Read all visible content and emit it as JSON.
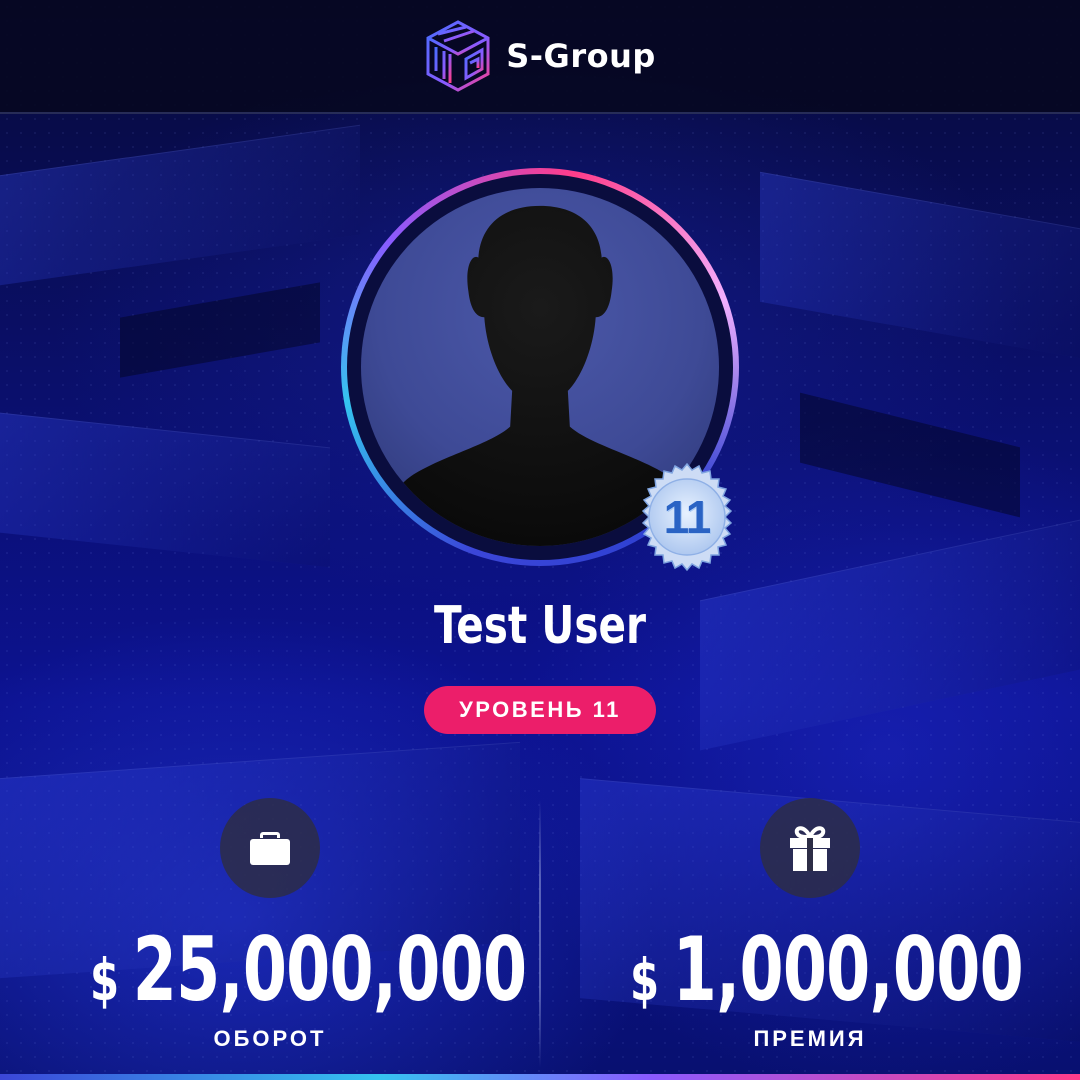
{
  "brand": {
    "name": "S-Group",
    "logo_icon": "cube-logo-icon"
  },
  "profile": {
    "name": "Test User",
    "level_number": "11",
    "level_label": "УРОВЕНЬ 11",
    "avatar_icon": "user-silhouette-icon"
  },
  "stats": {
    "turnover": {
      "currency": "$",
      "value": "25,000,000",
      "label": "ОБОРОТ",
      "icon": "briefcase-icon"
    },
    "bonus": {
      "currency": "$",
      "value": "1,000,000",
      "label": "ПРЕМИЯ",
      "icon": "gift-icon"
    }
  },
  "colors": {
    "accent_pink": "#ec1e6a",
    "background_blue": "#0a0f6a",
    "ring_cyan": "#35c4f0",
    "ring_pink": "#ff3d8a"
  }
}
